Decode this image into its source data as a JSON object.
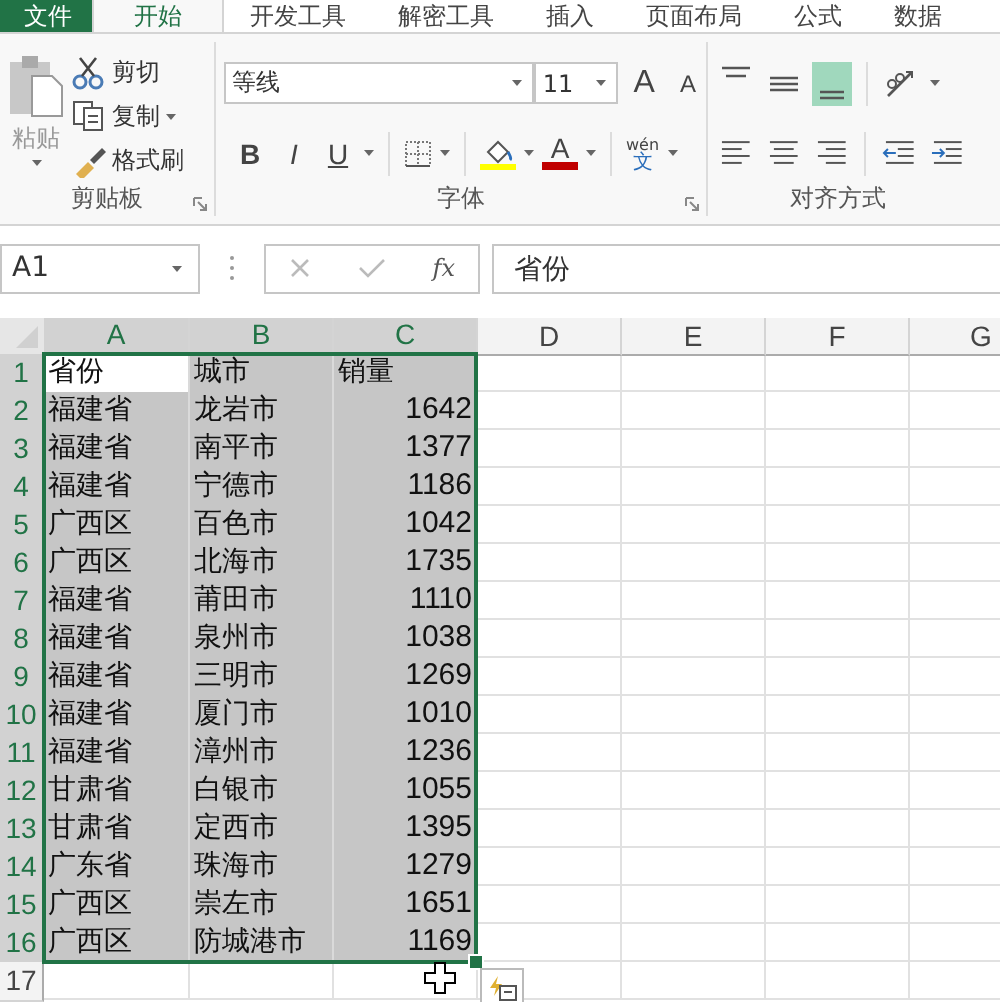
{
  "tabs": [
    {
      "label": "文件",
      "kind": "file",
      "selected": false
    },
    {
      "label": "开始",
      "kind": "tab",
      "selected": true
    },
    {
      "label": "开发工具",
      "kind": "tab",
      "selected": false
    },
    {
      "label": "解密工具",
      "kind": "tab",
      "selected": false
    },
    {
      "label": "插入",
      "kind": "tab",
      "selected": false
    },
    {
      "label": "页面布局",
      "kind": "tab",
      "selected": false
    },
    {
      "label": "公式",
      "kind": "tab",
      "selected": false
    },
    {
      "label": "数据",
      "kind": "tab",
      "selected": false
    }
  ],
  "clipboard": {
    "label": "剪贴板",
    "paste": "粘贴",
    "items": [
      {
        "label": "剪切",
        "kind": "cut"
      },
      {
        "label": "复制",
        "kind": "copy"
      },
      {
        "label": "格式刷",
        "kind": "painter"
      }
    ]
  },
  "font": {
    "label": "字体",
    "font_name": "等线",
    "font_size": "11",
    "grow": "A",
    "shrink": "A",
    "bold": "B",
    "italic": "I",
    "underline": "U",
    "font_color": "A",
    "phonetic_top": "wén",
    "phonetic_bottom": "文"
  },
  "alignment": {
    "label": "对齐方式",
    "vertical": [
      {
        "kind": "top",
        "selected": false
      },
      {
        "kind": "middle",
        "selected": false
      },
      {
        "kind": "bottom",
        "selected": true
      }
    ]
  },
  "formula_bar": {
    "name_box": "A1",
    "fx": "fx",
    "value": "省份"
  },
  "columns": [
    {
      "label": "A",
      "selected": true
    },
    {
      "label": "B",
      "selected": true
    },
    {
      "label": "C",
      "selected": true
    },
    {
      "label": "D",
      "selected": false
    },
    {
      "label": "E",
      "selected": false
    },
    {
      "label": "F",
      "selected": false
    },
    {
      "label": "G",
      "selected": false
    }
  ],
  "rows": [
    {
      "number": "1",
      "selected": true,
      "cells": [
        {
          "text": "省份",
          "kind": "text",
          "active": true
        },
        {
          "text": "城市",
          "kind": "text",
          "active": false
        },
        {
          "text": "销量",
          "kind": "text",
          "active": false
        }
      ]
    },
    {
      "number": "2",
      "selected": true,
      "cells": [
        {
          "text": "福建省",
          "kind": "text",
          "active": false
        },
        {
          "text": "龙岩市",
          "kind": "text",
          "active": false
        },
        {
          "text": "1642",
          "kind": "number",
          "active": false
        }
      ]
    },
    {
      "number": "3",
      "selected": true,
      "cells": [
        {
          "text": "福建省",
          "kind": "text",
          "active": false
        },
        {
          "text": "南平市",
          "kind": "text",
          "active": false
        },
        {
          "text": "1377",
          "kind": "number",
          "active": false
        }
      ]
    },
    {
      "number": "4",
      "selected": true,
      "cells": [
        {
          "text": "福建省",
          "kind": "text",
          "active": false
        },
        {
          "text": "宁德市",
          "kind": "text",
          "active": false
        },
        {
          "text": "1186",
          "kind": "number",
          "active": false
        }
      ]
    },
    {
      "number": "5",
      "selected": true,
      "cells": [
        {
          "text": "广西区",
          "kind": "text",
          "active": false
        },
        {
          "text": "百色市",
          "kind": "text",
          "active": false
        },
        {
          "text": "1042",
          "kind": "number",
          "active": false
        }
      ]
    },
    {
      "number": "6",
      "selected": true,
      "cells": [
        {
          "text": "广西区",
          "kind": "text",
          "active": false
        },
        {
          "text": "北海市",
          "kind": "text",
          "active": false
        },
        {
          "text": "1735",
          "kind": "number",
          "active": false
        }
      ]
    },
    {
      "number": "7",
      "selected": true,
      "cells": [
        {
          "text": "福建省",
          "kind": "text",
          "active": false
        },
        {
          "text": "莆田市",
          "kind": "text",
          "active": false
        },
        {
          "text": "1110",
          "kind": "number",
          "active": false
        }
      ]
    },
    {
      "number": "8",
      "selected": true,
      "cells": [
        {
          "text": "福建省",
          "kind": "text",
          "active": false
        },
        {
          "text": "泉州市",
          "kind": "text",
          "active": false
        },
        {
          "text": "1038",
          "kind": "number",
          "active": false
        }
      ]
    },
    {
      "number": "9",
      "selected": true,
      "cells": [
        {
          "text": "福建省",
          "kind": "text",
          "active": false
        },
        {
          "text": "三明市",
          "kind": "text",
          "active": false
        },
        {
          "text": "1269",
          "kind": "number",
          "active": false
        }
      ]
    },
    {
      "number": "10",
      "selected": true,
      "cells": [
        {
          "text": "福建省",
          "kind": "text",
          "active": false
        },
        {
          "text": "厦门市",
          "kind": "text",
          "active": false
        },
        {
          "text": "1010",
          "kind": "number",
          "active": false
        }
      ]
    },
    {
      "number": "11",
      "selected": true,
      "cells": [
        {
          "text": "福建省",
          "kind": "text",
          "active": false
        },
        {
          "text": "漳州市",
          "kind": "text",
          "active": false
        },
        {
          "text": "1236",
          "kind": "number",
          "active": false
        }
      ]
    },
    {
      "number": "12",
      "selected": true,
      "cells": [
        {
          "text": "甘肃省",
          "kind": "text",
          "active": false
        },
        {
          "text": "白银市",
          "kind": "text",
          "active": false
        },
        {
          "text": "1055",
          "kind": "number",
          "active": false
        }
      ]
    },
    {
      "number": "13",
      "selected": true,
      "cells": [
        {
          "text": "甘肃省",
          "kind": "text",
          "active": false
        },
        {
          "text": "定西市",
          "kind": "text",
          "active": false
        },
        {
          "text": "1395",
          "kind": "number",
          "active": false
        }
      ]
    },
    {
      "number": "14",
      "selected": true,
      "cells": [
        {
          "text": "广东省",
          "kind": "text",
          "active": false
        },
        {
          "text": "珠海市",
          "kind": "text",
          "active": false
        },
        {
          "text": "1279",
          "kind": "number",
          "active": false
        }
      ]
    },
    {
      "number": "15",
      "selected": true,
      "cells": [
        {
          "text": "广西区",
          "kind": "text",
          "active": false
        },
        {
          "text": "崇左市",
          "kind": "text",
          "active": false
        },
        {
          "text": "1651",
          "kind": "number",
          "active": false
        }
      ]
    },
    {
      "number": "16",
      "selected": true,
      "cells": [
        {
          "text": "广西区",
          "kind": "text",
          "active": false
        },
        {
          "text": "防城港市",
          "kind": "text",
          "active": false
        },
        {
          "text": "1169",
          "kind": "number",
          "active": false
        }
      ]
    },
    {
      "number": "17",
      "selected": false,
      "cells": []
    }
  ]
}
